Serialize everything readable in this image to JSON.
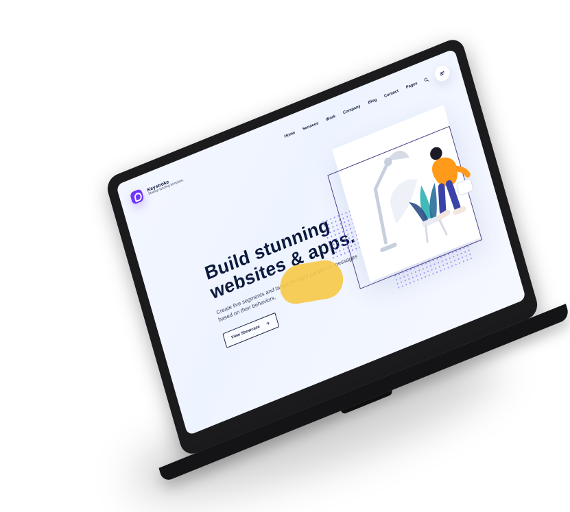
{
  "nav": {
    "brand_name": "Keystroke",
    "brand_tagline": "Startup landing template.",
    "menu": [
      {
        "label": "Home"
      },
      {
        "label": "Services"
      },
      {
        "label": "Work"
      },
      {
        "label": "Company"
      },
      {
        "label": "Blog"
      },
      {
        "label": "Contact"
      },
      {
        "label": "Pages"
      }
    ],
    "icons": {
      "search": "search-icon",
      "menu": "hamburger-menu-icon"
    }
  },
  "hero": {
    "headline_line1": "Build stunning",
    "headline_line2": "websites & apps.",
    "subtext": "Create live segments and target the right people for messages based on their behaviors.",
    "cta_label": "View Showcase"
  },
  "colors": {
    "primary": "#6f35ff",
    "navy": "#0b1a3d",
    "yellow": "#f7c948",
    "orange": "#ff9a1a"
  }
}
